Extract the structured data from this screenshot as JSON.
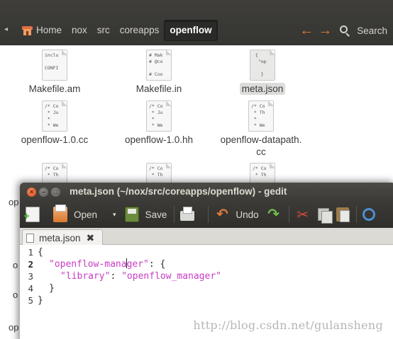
{
  "file_manager": {
    "breadcrumbs": [
      {
        "label": "Home",
        "icon": "home-icon"
      },
      {
        "label": "nox"
      },
      {
        "label": "src"
      },
      {
        "label": "coreapps"
      },
      {
        "label": "openflow"
      }
    ],
    "search_label": "Search",
    "files_row1": [
      {
        "name": "Makefile.am",
        "preview": "inclu\n\nCONFI"
      },
      {
        "name": "Makefile.in",
        "preview": "# Mak\n# @co\n\n# Coo"
      },
      {
        "name": "meta.json",
        "preview": " {\n  \"op\n\n   }"
      }
    ],
    "files_row2": [
      {
        "name": "openflow-1.0.cc",
        "preview": "/* Co\n * Ju\n *\n * We"
      },
      {
        "name": "openflow-1.0.hh",
        "preview": "/* Co\n * Ju\n *\n * We"
      },
      {
        "name": "openflow-datapath.\ncc",
        "preview": "/* Co\n * Th\n *\n * We"
      }
    ],
    "files_row3_preview": [
      "/* Co\n * Th",
      "/* Co\n * Th",
      "/* Co\n * Th"
    ],
    "edge_fragments": [
      "op",
      "o",
      "o",
      "op"
    ]
  },
  "gedit": {
    "title": "meta.json (~/nox/src/coreapps/openflow) - gedit",
    "toolbar": {
      "open_label": "Open",
      "save_label": "Save",
      "undo_label": "Undo"
    },
    "tab_label": "meta.json",
    "line_numbers": [
      "1",
      "2",
      "3",
      "4",
      "5"
    ],
    "code": {
      "l1": "{",
      "l2_key_a": "\"openflow-mana",
      "l2_key_b": "ger\"",
      "l2_rest": ": {",
      "l3_key": "\"library\"",
      "l3_sep": ": ",
      "l3_val": "\"openflow_manager\"",
      "l4": "}",
      "l5": "}"
    }
  },
  "watermark": "http://blog.csdn.net/gulansheng"
}
